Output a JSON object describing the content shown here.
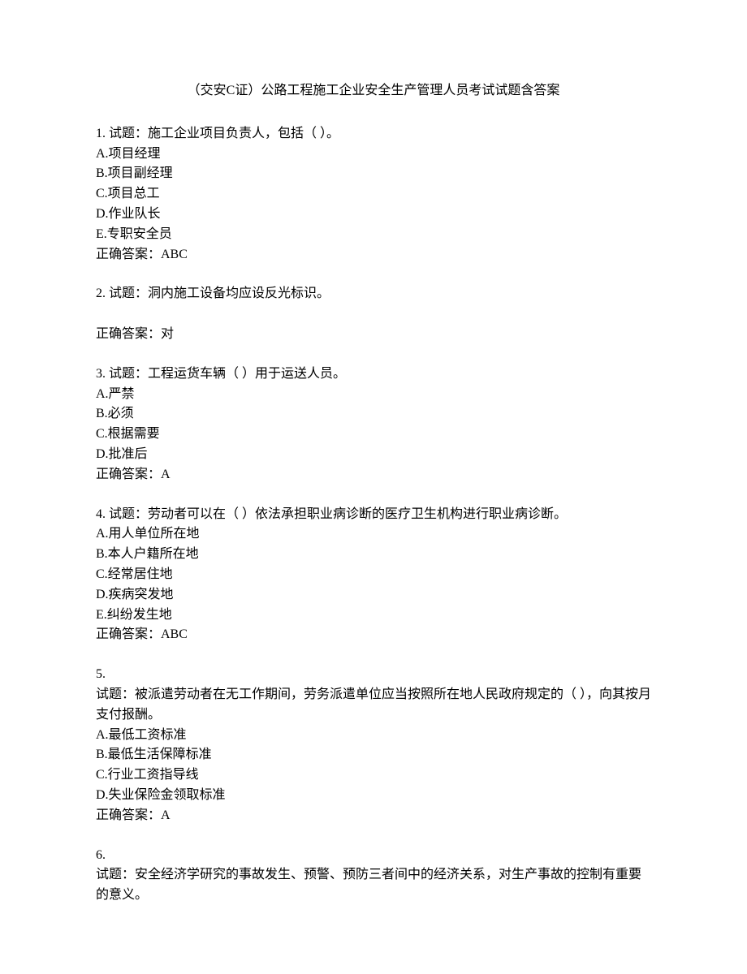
{
  "title": "（交安C证）公路工程施工企业安全生产管理人员考试试题含答案",
  "questions": [
    {
      "header": "1. 试题：施工企业项目负责人，包括（ ）。",
      "options": [
        "A.项目经理",
        "B.项目副经理",
        "C.项目总工",
        "D.作业队长",
        "E.专职安全员"
      ],
      "answer": "正确答案：ABC"
    },
    {
      "header": "2. 试题：洞内施工设备均应设反光标识。",
      "options": [],
      "spacer": true,
      "answer": "正确答案：对"
    },
    {
      "header": "3. 试题：工程运货车辆（ ）用于运送人员。",
      "options": [
        "A.严禁",
        "B.必须",
        "C.根据需要",
        "D.批准后"
      ],
      "answer": "正确答案：A"
    },
    {
      "header": "4. 试题：劳动者可以在（ ）依法承担职业病诊断的医疗卫生机构进行职业病诊断。",
      "options": [
        "A.用人单位所在地",
        "B.本人户籍所在地",
        "C.经常居住地",
        "D.疾病突发地",
        "E.纠纷发生地"
      ],
      "answer": "正确答案：ABC"
    },
    {
      "num": "5.",
      "header": "试题：被派遣劳动者在无工作期间，劳务派遣单位应当按照所在地人民政府规定的（ ），向其按月支付报酬。",
      "options": [
        "A.最低工资标准",
        "B.最低生活保障标准",
        "C.行业工资指导线",
        "D.失业保险金领取标准"
      ],
      "answer": "正确答案：A"
    },
    {
      "num": "6.",
      "header": "试题：安全经济学研究的事故发生、预警、预防三者间中的经济关系，对生产事故的控制有重要的意义。",
      "options": []
    }
  ]
}
